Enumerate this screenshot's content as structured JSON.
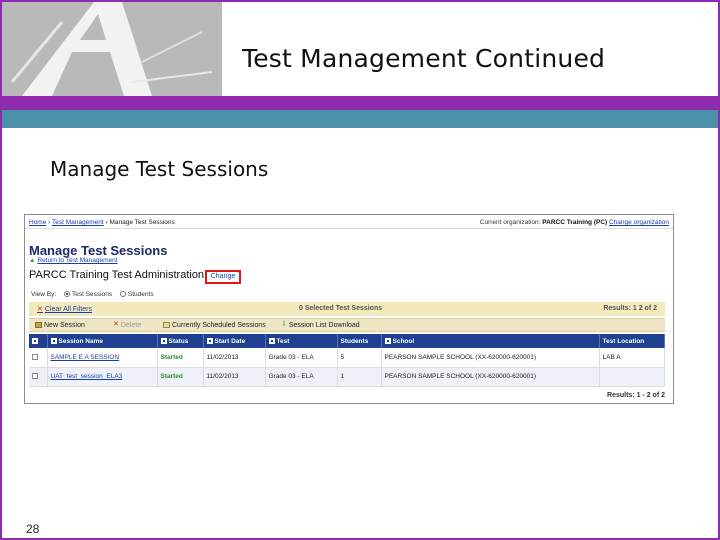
{
  "slide": {
    "title": "Test Management Continued",
    "subtitle": "Manage Test Sessions",
    "page_number": "28"
  },
  "colors": {
    "purple": "#8e2bb0",
    "teal": "#4a90a9",
    "header_blue": "#1f3f91",
    "highlight_red": "#e01818"
  },
  "screenshot": {
    "breadcrumb": {
      "home": "Home",
      "sep1": " › ",
      "test_management": "Test Management",
      "sep2": " › ",
      "current": "Manage Test Sessions"
    },
    "org": {
      "label": "Current organization:",
      "name": "PARCC Training (PC)",
      "change": "Change organization"
    },
    "page_heading": "Manage Test Sessions",
    "return_link": "Return to Test Management",
    "administration": "PARCC Training Test Administration",
    "change_link": "Change",
    "view_by": {
      "label": "View By:",
      "options": [
        "Test Sessions",
        "Students"
      ],
      "selected": "Test Sessions"
    },
    "clear_filters": "Clear All Filters",
    "selected_count": "0 Selected Test Sessions",
    "results_top": "Results: 1 2 of 2",
    "toolbar": {
      "new_session": "New Session",
      "delete": "Delete",
      "currently_scheduled": "Currently Scheduled Sessions",
      "session_download": "Session List Download"
    },
    "table": {
      "columns": [
        "Session Name",
        "Status",
        "Start Date",
        "Test",
        "Students",
        "School",
        "Test Location"
      ],
      "rows": [
        {
          "session_name": "SAMPLE E A SESSION",
          "status": "Started",
          "start_date": "11/02/2013",
          "test": "Grade 03 - ELA",
          "students": "5",
          "school": "PEARSON SAMPLE SCHOOL (XX-620000-620001)",
          "location": "LAB A"
        },
        {
          "session_name": "UAT_test_session_ELA3",
          "status": "Started",
          "start_date": "11/02/2013",
          "test": "Grade 03 - ELA",
          "students": "1",
          "school": "PEARSON SAMPLE SCHOOL (XX-620000-620001)",
          "location": ""
        }
      ]
    },
    "results_bottom": "Results: 1 - 2 of 2"
  }
}
